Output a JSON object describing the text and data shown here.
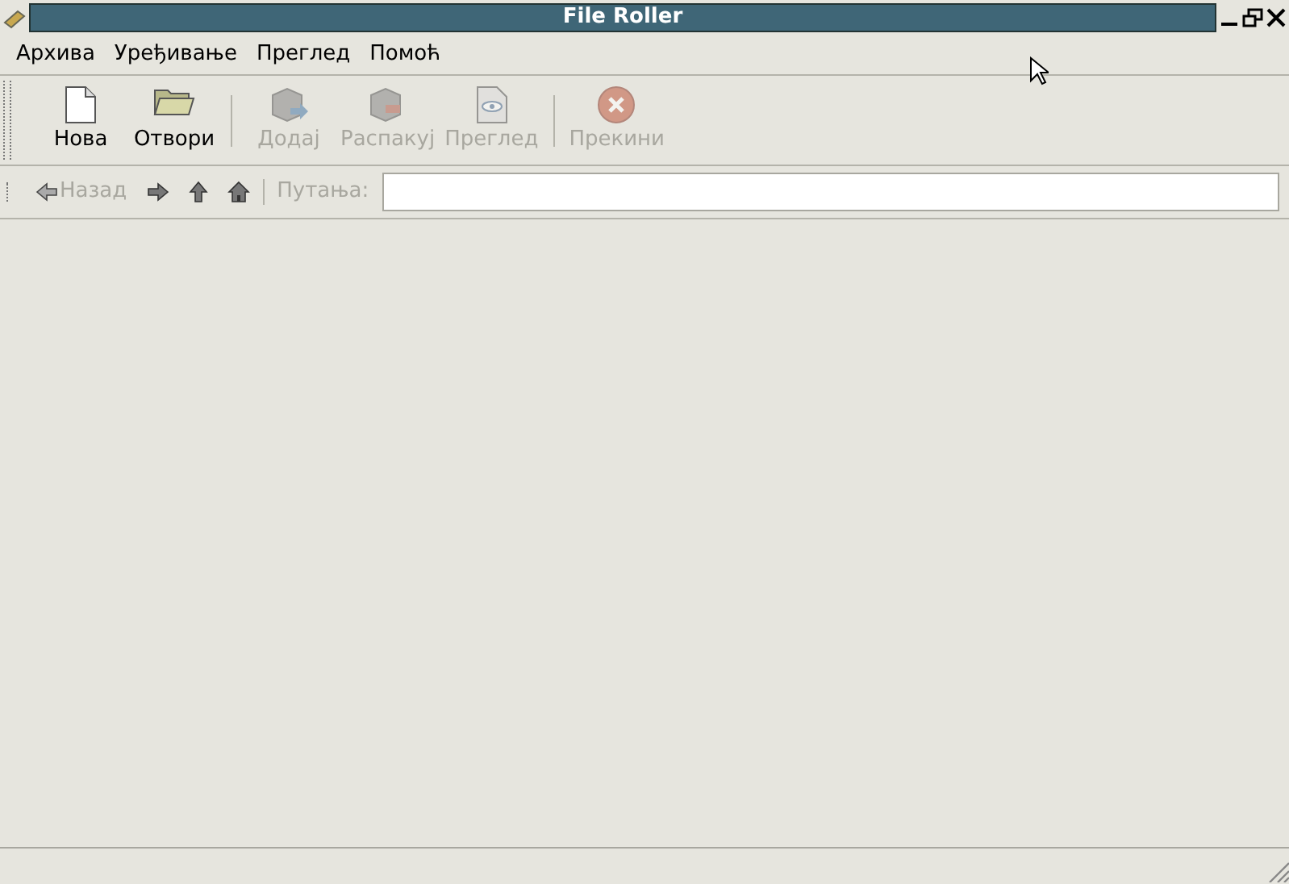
{
  "window": {
    "title": "File Roller"
  },
  "menu": [
    {
      "label": "Архива"
    },
    {
      "label": "Уређивање"
    },
    {
      "label": "Преглед"
    },
    {
      "label": "Помоћ"
    }
  ],
  "toolbar_groups": [
    [
      {
        "kind": "new",
        "label": "Нова",
        "disabled": false
      },
      {
        "kind": "open",
        "label": "Отвори",
        "disabled": false
      }
    ],
    [
      {
        "kind": "add",
        "label": "Додај",
        "disabled": true
      },
      {
        "kind": "extract",
        "label": "Распакуј",
        "disabled": true
      },
      {
        "kind": "view",
        "label": "Преглед",
        "disabled": true
      }
    ],
    [
      {
        "kind": "stop",
        "label": "Прекини",
        "disabled": true
      }
    ]
  ],
  "nav": [
    {
      "kind": "back",
      "label": "Назад",
      "disabled": true
    },
    {
      "kind": "forward",
      "disabled": false
    },
    {
      "kind": "up",
      "disabled": false
    },
    {
      "kind": "home",
      "disabled": false
    }
  ],
  "location": {
    "label": "Путања:",
    "disabled": true
  }
}
